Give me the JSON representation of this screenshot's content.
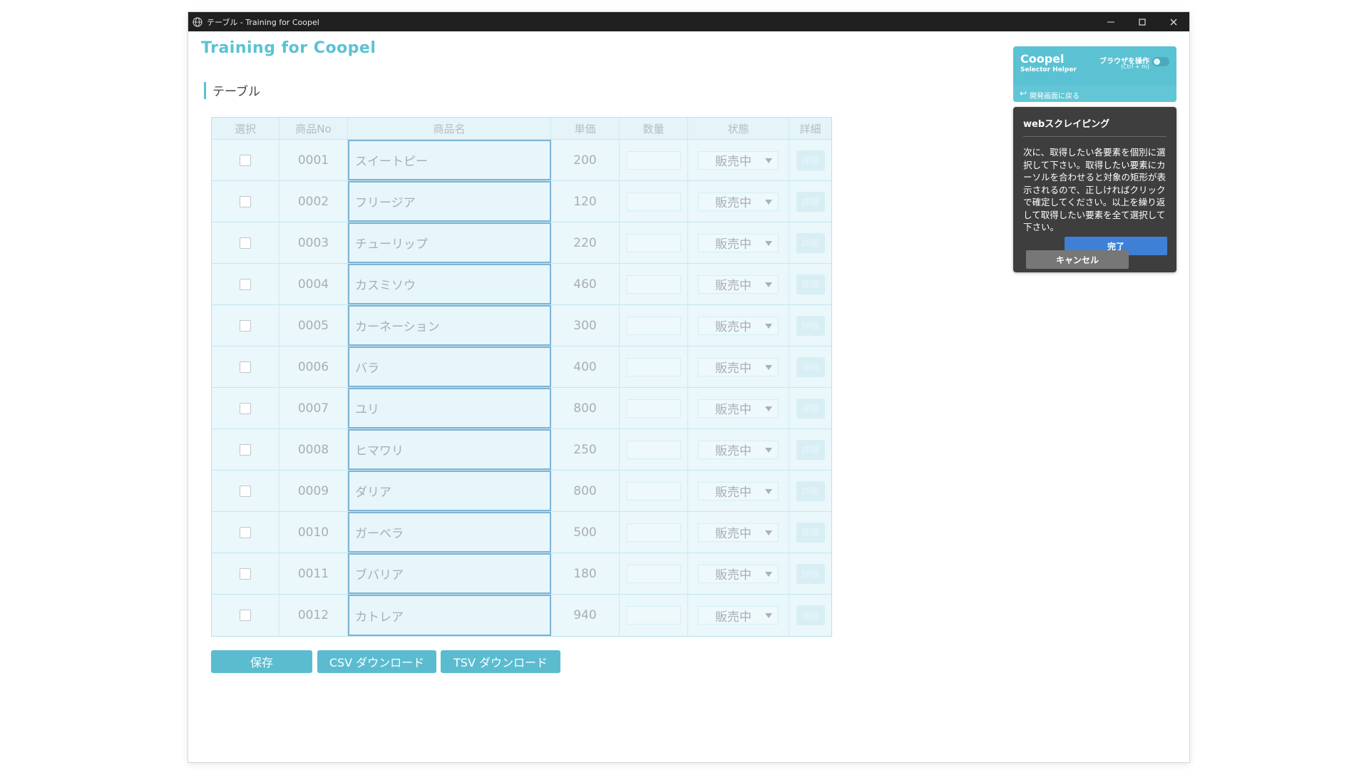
{
  "window": {
    "title": "テーブル - Training for Coopel"
  },
  "app": {
    "title": "Training for Coopel"
  },
  "section": {
    "title": "テーブル"
  },
  "table": {
    "headers": [
      "選択",
      "商品No",
      "商品名",
      "単価",
      "数量",
      "状態",
      "詳細"
    ],
    "rows": [
      {
        "no": "0001",
        "name": "スイートピー",
        "price": "200",
        "status": "販売中"
      },
      {
        "no": "0002",
        "name": "フリージア",
        "price": "120",
        "status": "販売中"
      },
      {
        "no": "0003",
        "name": "チューリップ",
        "price": "220",
        "status": "販売中"
      },
      {
        "no": "0004",
        "name": "カスミソウ",
        "price": "460",
        "status": "販売中"
      },
      {
        "no": "0005",
        "name": "カーネーション",
        "price": "300",
        "status": "販売中"
      },
      {
        "no": "0006",
        "name": "バラ",
        "price": "400",
        "status": "販売中"
      },
      {
        "no": "0007",
        "name": "ユリ",
        "price": "800",
        "status": "販売中"
      },
      {
        "no": "0008",
        "name": "ヒマワリ",
        "price": "250",
        "status": "販売中"
      },
      {
        "no": "0009",
        "name": "ダリア",
        "price": "800",
        "status": "販売中"
      },
      {
        "no": "0010",
        "name": "ガーベラ",
        "price": "500",
        "status": "販売中"
      },
      {
        "no": "0011",
        "name": "ブバリア",
        "price": "180",
        "status": "販売中"
      },
      {
        "no": "0012",
        "name": "カトレア",
        "price": "940",
        "status": "販売中"
      }
    ],
    "detail_label": "詳細"
  },
  "buttons": {
    "save": "保存",
    "csv": "CSV ダウンロード",
    "tsv": "TSV ダウンロード"
  },
  "helper": {
    "brand": "Coopel",
    "subtitle": "Selector Helper",
    "browser_op": "ブラウザを操作",
    "shortcut": "(Ctrl + m)",
    "back": "開発画面に戻る"
  },
  "panel": {
    "title": "webスクレイピング",
    "body": "次に、取得したい各要素を個別に選択して下さい。取得したい要素にカーソルを合わせると対象の矩形が表示されるので、正しければクリックで確定してください。以上を繰り返して取得したい要素を全て選択して下さい。",
    "done": "完了",
    "cancel": "キャンセル"
  },
  "colors": {
    "accent": "#5bc2d3",
    "button": "#5bbcd0",
    "panel": "#3e3e3e",
    "done": "#3d80d6",
    "titlebar": "#202020"
  },
  "icons": {
    "window": "globe-icon",
    "minimize": "minimize-icon",
    "maximize": "maximize-icon",
    "close": "close-icon",
    "back": "return-arrow-icon",
    "dropdown": "caret-down-icon"
  }
}
